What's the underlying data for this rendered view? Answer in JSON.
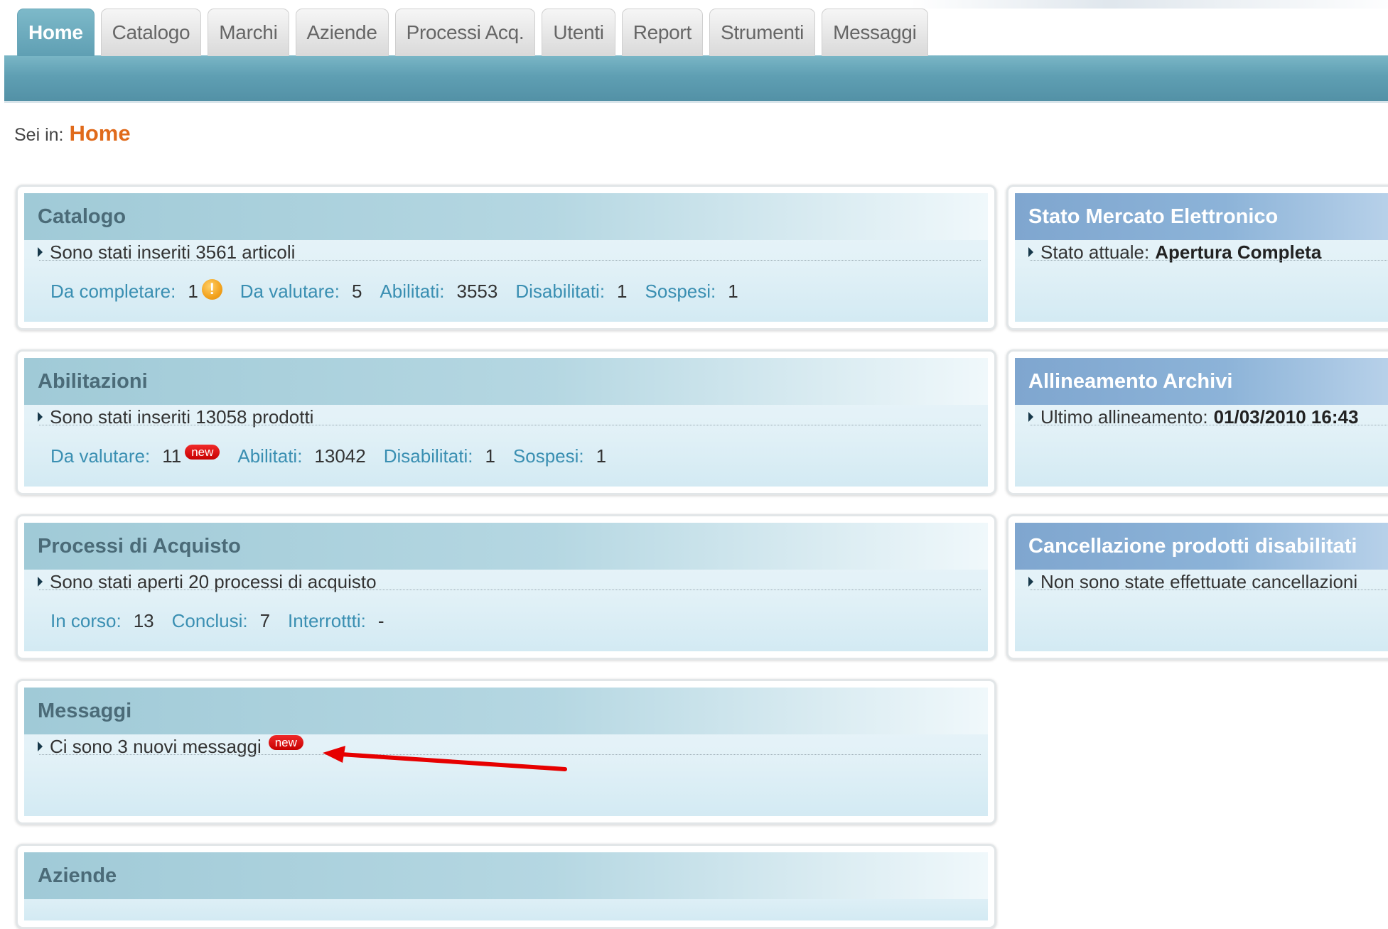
{
  "nav": {
    "tabs": [
      {
        "label": "Home",
        "active": true
      },
      {
        "label": "Catalogo"
      },
      {
        "label": "Marchi"
      },
      {
        "label": "Aziende"
      },
      {
        "label": "Processi Acq."
      },
      {
        "label": "Utenti"
      },
      {
        "label": "Report"
      },
      {
        "label": "Strumenti"
      },
      {
        "label": "Messaggi"
      }
    ]
  },
  "breadcrumb": {
    "label": "Sei in:",
    "current": "Home"
  },
  "panels": {
    "catalogo": {
      "title": "Catalogo",
      "summary": "Sono stati inseriti 3561 articoli",
      "stats": [
        {
          "label": "Da completare:",
          "value": "1"
        },
        {
          "label": "Da valutare:",
          "value": "5"
        },
        {
          "label": "Abilitati:",
          "value": "3553"
        },
        {
          "label": "Disabilitati:",
          "value": "1"
        },
        {
          "label": "Sospesi:",
          "value": "1"
        }
      ],
      "warning_icon": "!"
    },
    "abilitazioni": {
      "title": "Abilitazioni",
      "summary": "Sono stati inseriti 13058 prodotti",
      "stats": [
        {
          "label": "Da valutare:",
          "value": "11"
        },
        {
          "label": "Abilitati:",
          "value": "13042"
        },
        {
          "label": "Disabilitati:",
          "value": "1"
        },
        {
          "label": "Sospesi:",
          "value": "1"
        }
      ]
    },
    "processi": {
      "title": "Processi di Acquisto",
      "summary": "Sono stati aperti 20 processi di acquisto",
      "stats": [
        {
          "label": "In corso:",
          "value": "13"
        },
        {
          "label": "Conclusi:",
          "value": "7"
        },
        {
          "label": "Interrottti:",
          "value": "-"
        }
      ]
    },
    "messaggi": {
      "title": "Messaggi",
      "summary": "Ci sono 3 nuovi messaggi"
    },
    "aziende": {
      "title": "Aziende"
    },
    "stato_mercato": {
      "title": "Stato Mercato Elettronico",
      "label": "Stato attuale:",
      "value": "Apertura Completa"
    },
    "allineamento": {
      "title": "Allineamento Archivi",
      "label": "Ultimo allineamento:",
      "value": "01/03/2010 16:43"
    },
    "cancellazione": {
      "title": "Cancellazione prodotti disabilitati",
      "summary": "Non sono state effettuate cancellazioni"
    }
  },
  "badge_text": "new",
  "colors": {
    "nav_bar": "#5f9fb3",
    "accent_orange": "#e06a1b",
    "stat_label": "#3a8fb2",
    "badge_red": "#d90000",
    "annotation_arrow": "#e60000"
  }
}
